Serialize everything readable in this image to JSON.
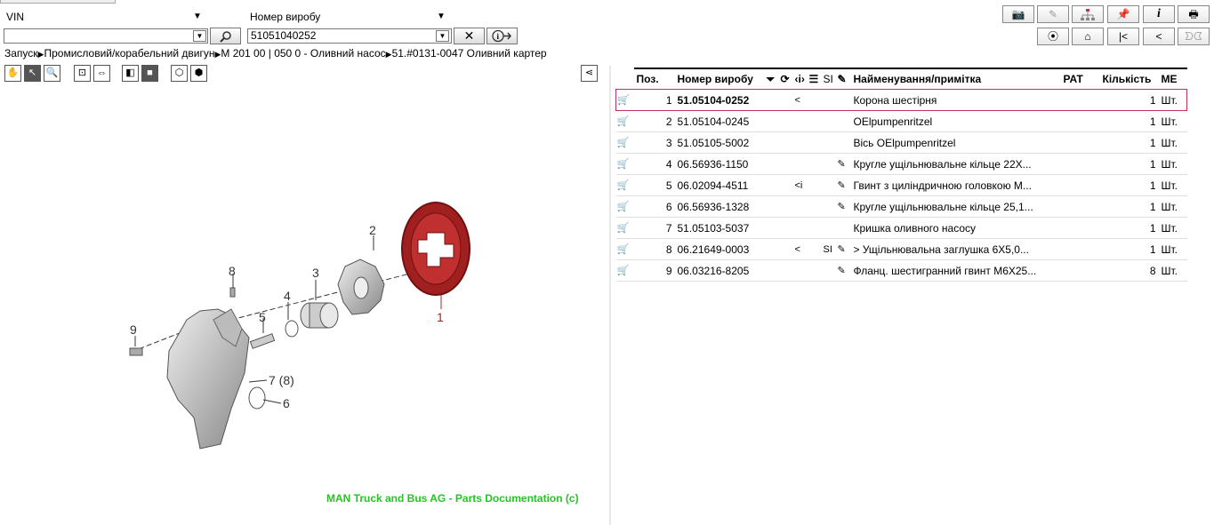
{
  "search": {
    "vin_label": "VIN",
    "vin_value": "",
    "product_label": "Номер виробу",
    "product_value": "51051040252"
  },
  "breadcrumb": {
    "items": [
      "Запуск",
      "Промисловий/корабельний двигун",
      "M 201 00 | 050 0 - Оливний насос",
      "51.#0131-0047  Оливний картер"
    ]
  },
  "diagram": {
    "callouts": [
      "1",
      "2",
      "3",
      "4",
      "5",
      "6",
      "7 (8)",
      "8",
      "9"
    ],
    "copyright": "MAN Truck and Bus AG - Parts Documentation (c)"
  },
  "table": {
    "headers": {
      "pos": "Поз.",
      "part_no": "Номер виробу",
      "si": "SI",
      "name": "Найменування/примітка",
      "rat": "РАТ",
      "qty": "Кількість",
      "unit": "МЕ"
    },
    "rows": [
      {
        "pos": "1",
        "part_no": "51.05104-0252",
        "flag": "<",
        "si": "",
        "tool": "",
        "name": "Корона шестірня",
        "qty": "1",
        "unit": "Шт."
      },
      {
        "pos": "2",
        "part_no": "51.05104-0245",
        "flag": "",
        "si": "",
        "tool": "",
        "name": "OElpumpenritzel",
        "qty": "1",
        "unit": "Шт."
      },
      {
        "pos": "3",
        "part_no": "51.05105-5002",
        "flag": "",
        "si": "",
        "tool": "",
        "name": "Вісь OElpumpenritzel",
        "qty": "1",
        "unit": "Шт."
      },
      {
        "pos": "4",
        "part_no": "06.56936-1150",
        "flag": "",
        "si": "",
        "tool": "✎",
        "name": "Кругле ущільнювальне кільце  22X...",
        "qty": "1",
        "unit": "Шт."
      },
      {
        "pos": "5",
        "part_no": "06.02094-4511",
        "flag": "<i",
        "si": "",
        "tool": "✎",
        "name": "Гвинт з циліндричною головкою  M...",
        "qty": "1",
        "unit": "Шт."
      },
      {
        "pos": "6",
        "part_no": "06.56936-1328",
        "flag": "",
        "si": "",
        "tool": "✎",
        "name": "Кругле ущільнювальне кільце  25,1...",
        "qty": "1",
        "unit": "Шт."
      },
      {
        "pos": "7",
        "part_no": "51.05103-5037",
        "flag": "",
        "si": "",
        "tool": "",
        "name": "Кришка оливного насосу",
        "qty": "1",
        "unit": "Шт."
      },
      {
        "pos": "8",
        "part_no": "06.21649-0003",
        "flag": "<",
        "si": "SI",
        "tool": "✎",
        "name": "  > Ущільнювальна заглушка  6X5,0...",
        "qty": "1",
        "unit": "Шт."
      },
      {
        "pos": "9",
        "part_no": "06.03216-8205",
        "flag": "",
        "si": "",
        "tool": "✎",
        "name": "Фланц. шестигранний гвинт  M6X25...",
        "qty": "8",
        "unit": "Шт."
      }
    ]
  },
  "toolbar": {
    "info_label": "i",
    "first_label": "|<",
    "prev_label": "<"
  },
  "colors": {
    "selected_border": "#c03060",
    "copyright": "#25c425",
    "ring_gear": "#a02020",
    "callout_1": "#b02020"
  }
}
